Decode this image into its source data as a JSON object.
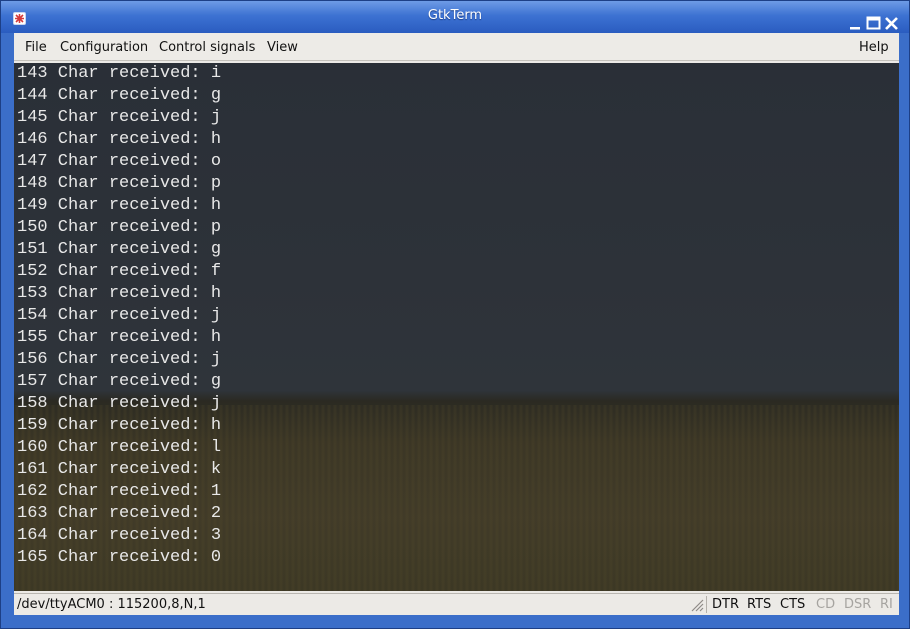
{
  "window": {
    "title": "GtkTerm"
  },
  "menubar": {
    "file": "File",
    "configuration": "Configuration",
    "control_signals": "Control signals",
    "view": "View",
    "help": "Help"
  },
  "terminal": {
    "lines": [
      "143 Char received: i",
      "144 Char received: g",
      "145 Char received: j",
      "146 Char received: h",
      "147 Char received: o",
      "148 Char received: p",
      "149 Char received: h",
      "150 Char received: p",
      "151 Char received: g",
      "152 Char received: f",
      "153 Char received: h",
      "154 Char received: j",
      "155 Char received: h",
      "156 Char received: j",
      "157 Char received: g",
      "158 Char received: j",
      "159 Char received: h",
      "160 Char received: l",
      "161 Char received: k",
      "162 Char received: 1",
      "163 Char received: 2",
      "164 Char received: 3",
      "165 Char received: 0"
    ]
  },
  "statusbar": {
    "port_info": "/dev/ttyACM0 : 115200,8,N,1",
    "signals": [
      {
        "label": "DTR",
        "active": true
      },
      {
        "label": "RTS",
        "active": true
      },
      {
        "label": "CTS",
        "active": true
      },
      {
        "label": "CD",
        "active": false
      },
      {
        "label": "DSR",
        "active": false
      },
      {
        "label": "RI",
        "active": false
      }
    ]
  },
  "colors": {
    "titlebar": "#3d72d2",
    "terminal_text": "#e8e8e8",
    "signal_active": "#111111",
    "signal_inactive": "#a6a4a0"
  }
}
